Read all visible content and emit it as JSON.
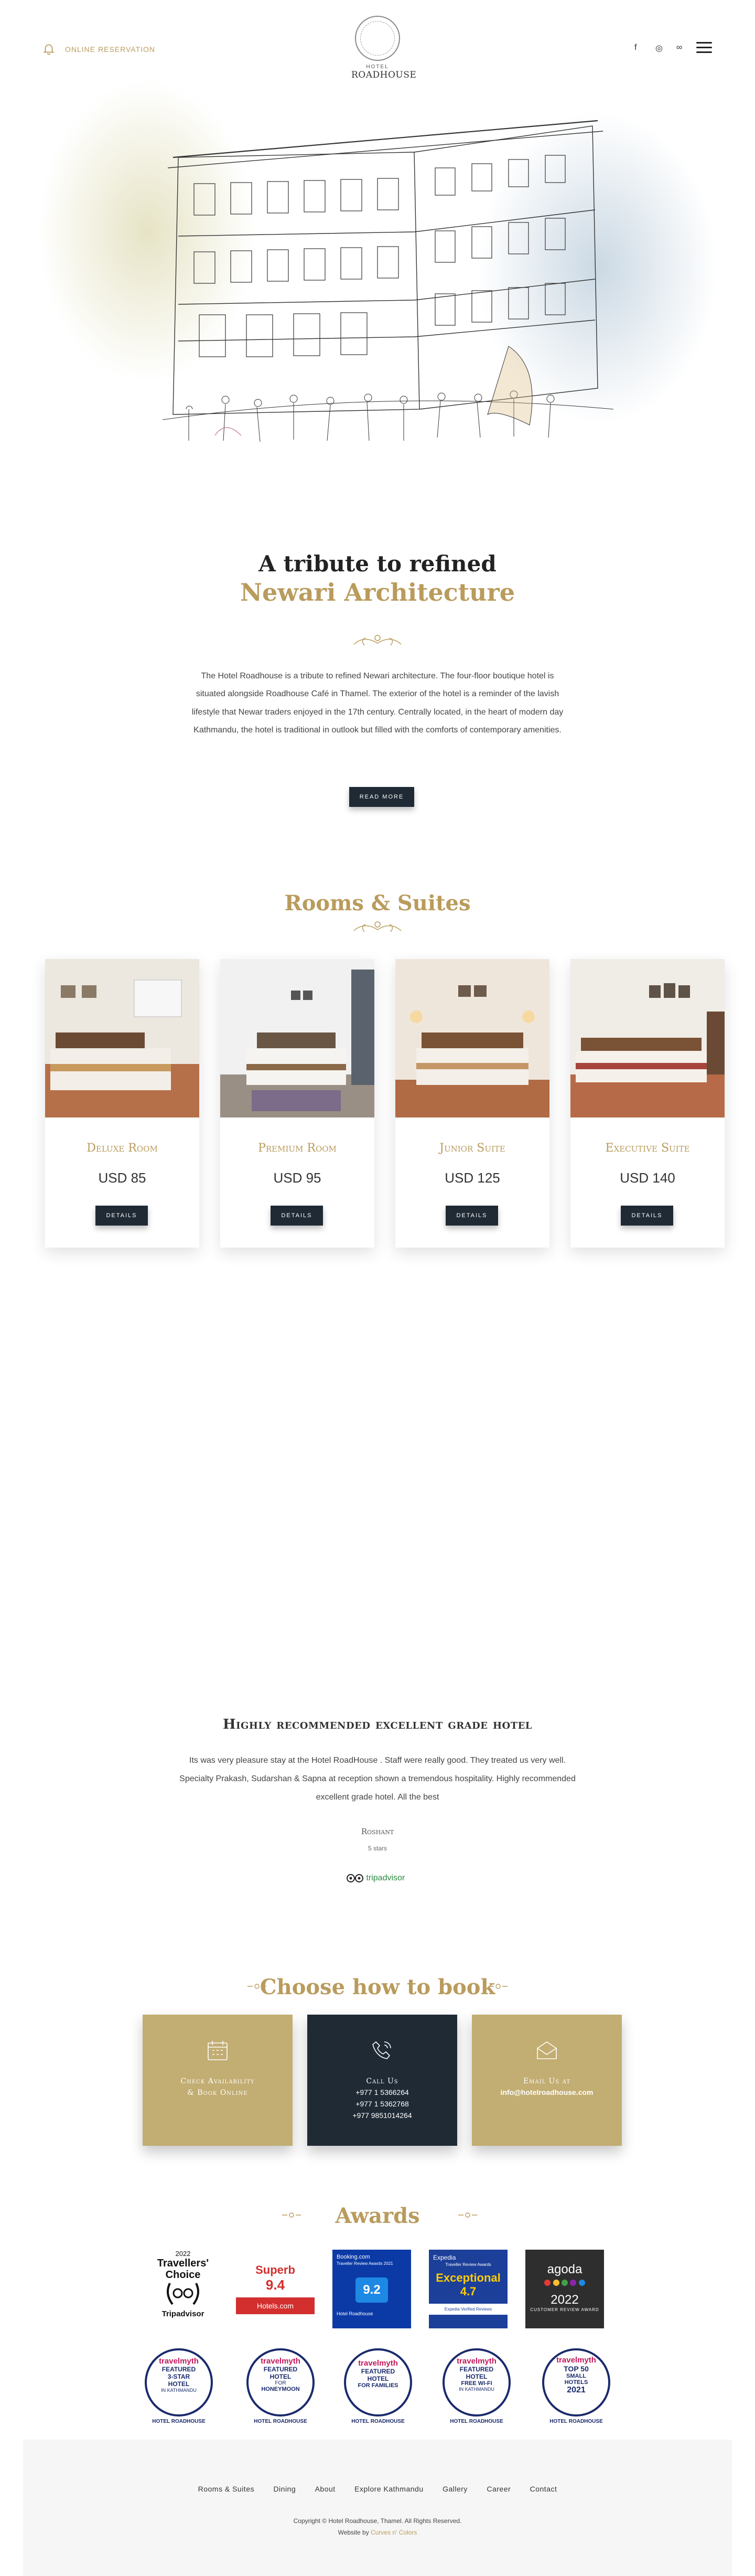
{
  "header": {
    "reservation_link": "ONLINE RESERVATION",
    "logo_small": "HOTEL",
    "logo_name": "ROADHOUSE",
    "social": [
      "f",
      "◎",
      "∞"
    ]
  },
  "tribute": {
    "title": "A tribute to refined",
    "subtitle": "Newari Architecture",
    "text": "The Hotel Roadhouse is a tribute to refined Newari architecture. The four-floor boutique hotel is situated alongside Roadhouse Café in Thamel. The exterior of the hotel is a reminder of the lavish lifestyle that Newar traders enjoyed in the 17th century. Centrally located, in the heart of modern day Kathmandu, the hotel is traditional in outlook but filled with the comforts of contemporary amenities.",
    "button": "READ MORE"
  },
  "rooms": {
    "title": "Rooms & Suites",
    "items": [
      {
        "name": "Deluxe Room",
        "price": "USD 85",
        "button": "DETAILS"
      },
      {
        "name": "Premium Room",
        "price": "USD 95",
        "button": "DETAILS"
      },
      {
        "name": "Junior Suite",
        "price": "USD 125",
        "button": "DETAILS"
      },
      {
        "name": "Executive Suite",
        "price": "USD 140",
        "button": "DETAILS"
      }
    ]
  },
  "review": {
    "title": "Highly recommended excellent grade hotel",
    "text": "Its was very pleasure stay at the Hotel RoadHouse . Staff were really good. They treated us very well. Specialty Prakash, Sudarshan & Sapna at reception shown a tremendous hospitality. Highly recommended excellent grade hotel. All the best",
    "author": "Roshant",
    "rating": "5 stars",
    "source": "tripadvisor"
  },
  "booking": {
    "title": "Choose how to book",
    "cards": [
      {
        "label_line1": "Check Availability",
        "label_line2": "& Book Online",
        "icon": "calendar-icon"
      },
      {
        "label_line1": "Call Us",
        "phones": [
          "+977 1 5366264",
          "+977 1 5362768",
          "+977 9851014264"
        ],
        "icon": "phone-icon"
      },
      {
        "label_line1": "Email Us at",
        "email": "info@hotelroadhouse.com",
        "icon": "envelope-icon"
      }
    ],
    "colors": {
      "gold": "#c2ad72",
      "dark": "#1f2a35"
    }
  },
  "awards": {
    "title": "Awards",
    "row1": [
      {
        "line1": "2022",
        "line2": "Travellers'",
        "line3": "Choice",
        "line4": "Tripadvisor"
      },
      {
        "line1": "Superb",
        "line2": "9.4",
        "line3": "Hotels.com"
      },
      {
        "line1": "Booking.com",
        "line2": "Traveller Review Awards 2021",
        "line3": "9.2",
        "line4": "Hotel Roadhouse"
      },
      {
        "line1": "Expedia",
        "line2": "Traveller Review Awards",
        "line3": "Exceptional",
        "line4": "4.7",
        "line5": "Expedia Verified Reviews"
      },
      {
        "line1": "agoda",
        "line2": "2022",
        "line3": "CUSTOMER REVIEW AWARD"
      }
    ],
    "row2": [
      {
        "brand": "travelmyth",
        "line1": "FEATURED",
        "line2": "3-STAR",
        "line3": "HOTEL",
        "line4": "IN KATHMANDU",
        "name": "HOTEL ROADHOUSE"
      },
      {
        "brand": "travelmyth",
        "line1": "FEATURED",
        "line2": "HOTEL",
        "line3": "FOR",
        "line4": "HONEYMOON",
        "name": "HOTEL ROADHOUSE"
      },
      {
        "brand": "travelmyth",
        "line1": "FEATURED",
        "line2": "HOTEL",
        "line3": "FOR FAMILIES",
        "line4": "",
        "name": "HOTEL ROADHOUSE"
      },
      {
        "brand": "travelmyth",
        "line1": "FEATURED",
        "line2": "HOTEL",
        "line3": "FREE WI-FI",
        "line4": "IN KATHMANDU",
        "name": "HOTEL ROADHOUSE"
      },
      {
        "brand": "travelmyth",
        "line1": "TOP 50",
        "line2": "SMALL",
        "line3": "HOTELS",
        "line4": "2021",
        "name": "HOTEL ROADHOUSE"
      }
    ]
  },
  "footer": {
    "nav": [
      "Rooms & Suites",
      "Dining",
      "About",
      "Explore Kathmandu",
      "Gallery",
      "Career",
      "Contact"
    ],
    "copyright": "Copyright © Hotel Roadhouse, Thamel. All Rights Reserved.",
    "website_by_prefix": "Website by",
    "website_by": "Curves n' Colors"
  }
}
